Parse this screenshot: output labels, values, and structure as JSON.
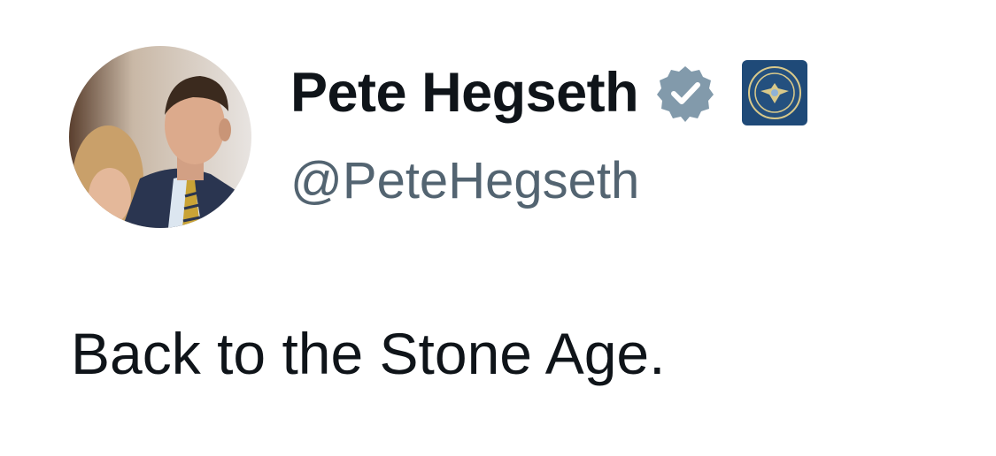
{
  "author": {
    "display_name": "Pete Hegseth",
    "handle": "@PeteHegseth",
    "verified_icon": "verified-badge-icon",
    "affiliation_icon": "affiliation-seal-icon"
  },
  "tweet": {
    "text": "Back to the Stone Age."
  },
  "colors": {
    "text_primary": "#0f1419",
    "text_secondary": "#536471",
    "verified_badge": "#829aab",
    "affiliation_badge_bg": "#1f4a78"
  }
}
